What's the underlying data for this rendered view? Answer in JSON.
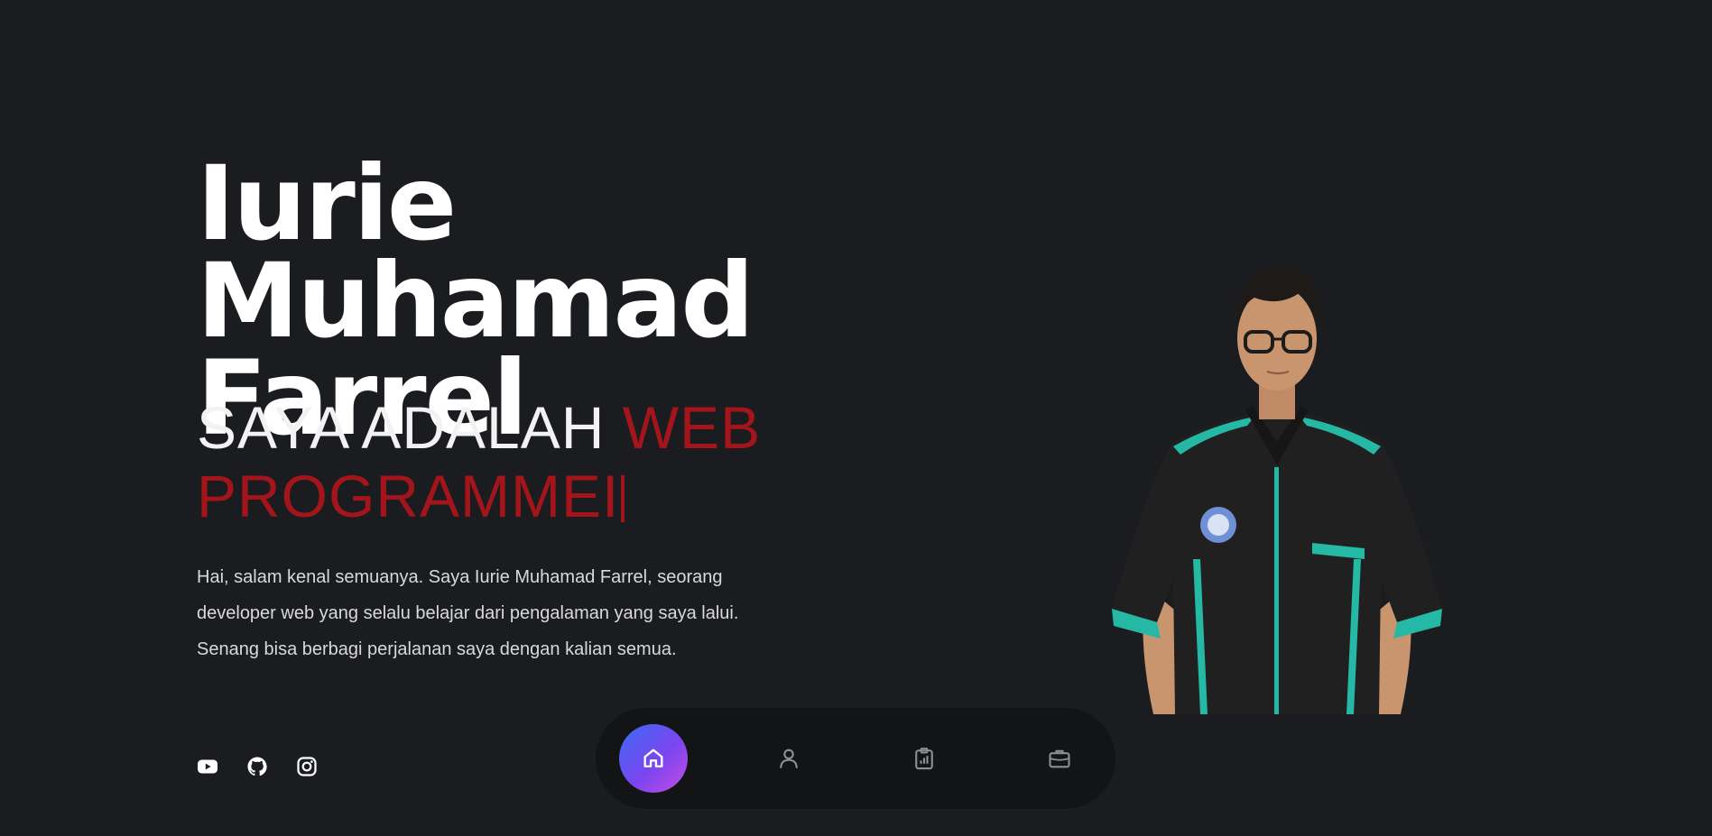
{
  "hero": {
    "name_line1": "Iurie Muhamad",
    "name_line2": "Farrel",
    "role_prefix": "SAYA ADALAH ",
    "role_highlight": "WEB PROGRAMMEI",
    "intro_line1": "Hai, salam kenal semuanya. Saya Iurie Muhamad Farrel, seorang",
    "intro_line2": "developer web yang selalu belajar dari pengalaman yang saya lalui.",
    "intro_line3": "Senang bisa berbagi perjalanan saya dengan kalian semua."
  },
  "socials": [
    {
      "icon": "youtube-icon"
    },
    {
      "icon": "github-icon"
    },
    {
      "icon": "instagram-icon"
    }
  ],
  "dock": [
    {
      "icon": "home-icon",
      "active": true
    },
    {
      "icon": "user-icon",
      "active": false
    },
    {
      "icon": "clipboard-chart-icon",
      "active": false
    },
    {
      "icon": "briefcase-icon",
      "active": false
    }
  ],
  "colors": {
    "background": "#1a1c1f",
    "accent": "#a3151b",
    "dock_background": "#121416",
    "shirt_trim": "#25b9a5"
  }
}
